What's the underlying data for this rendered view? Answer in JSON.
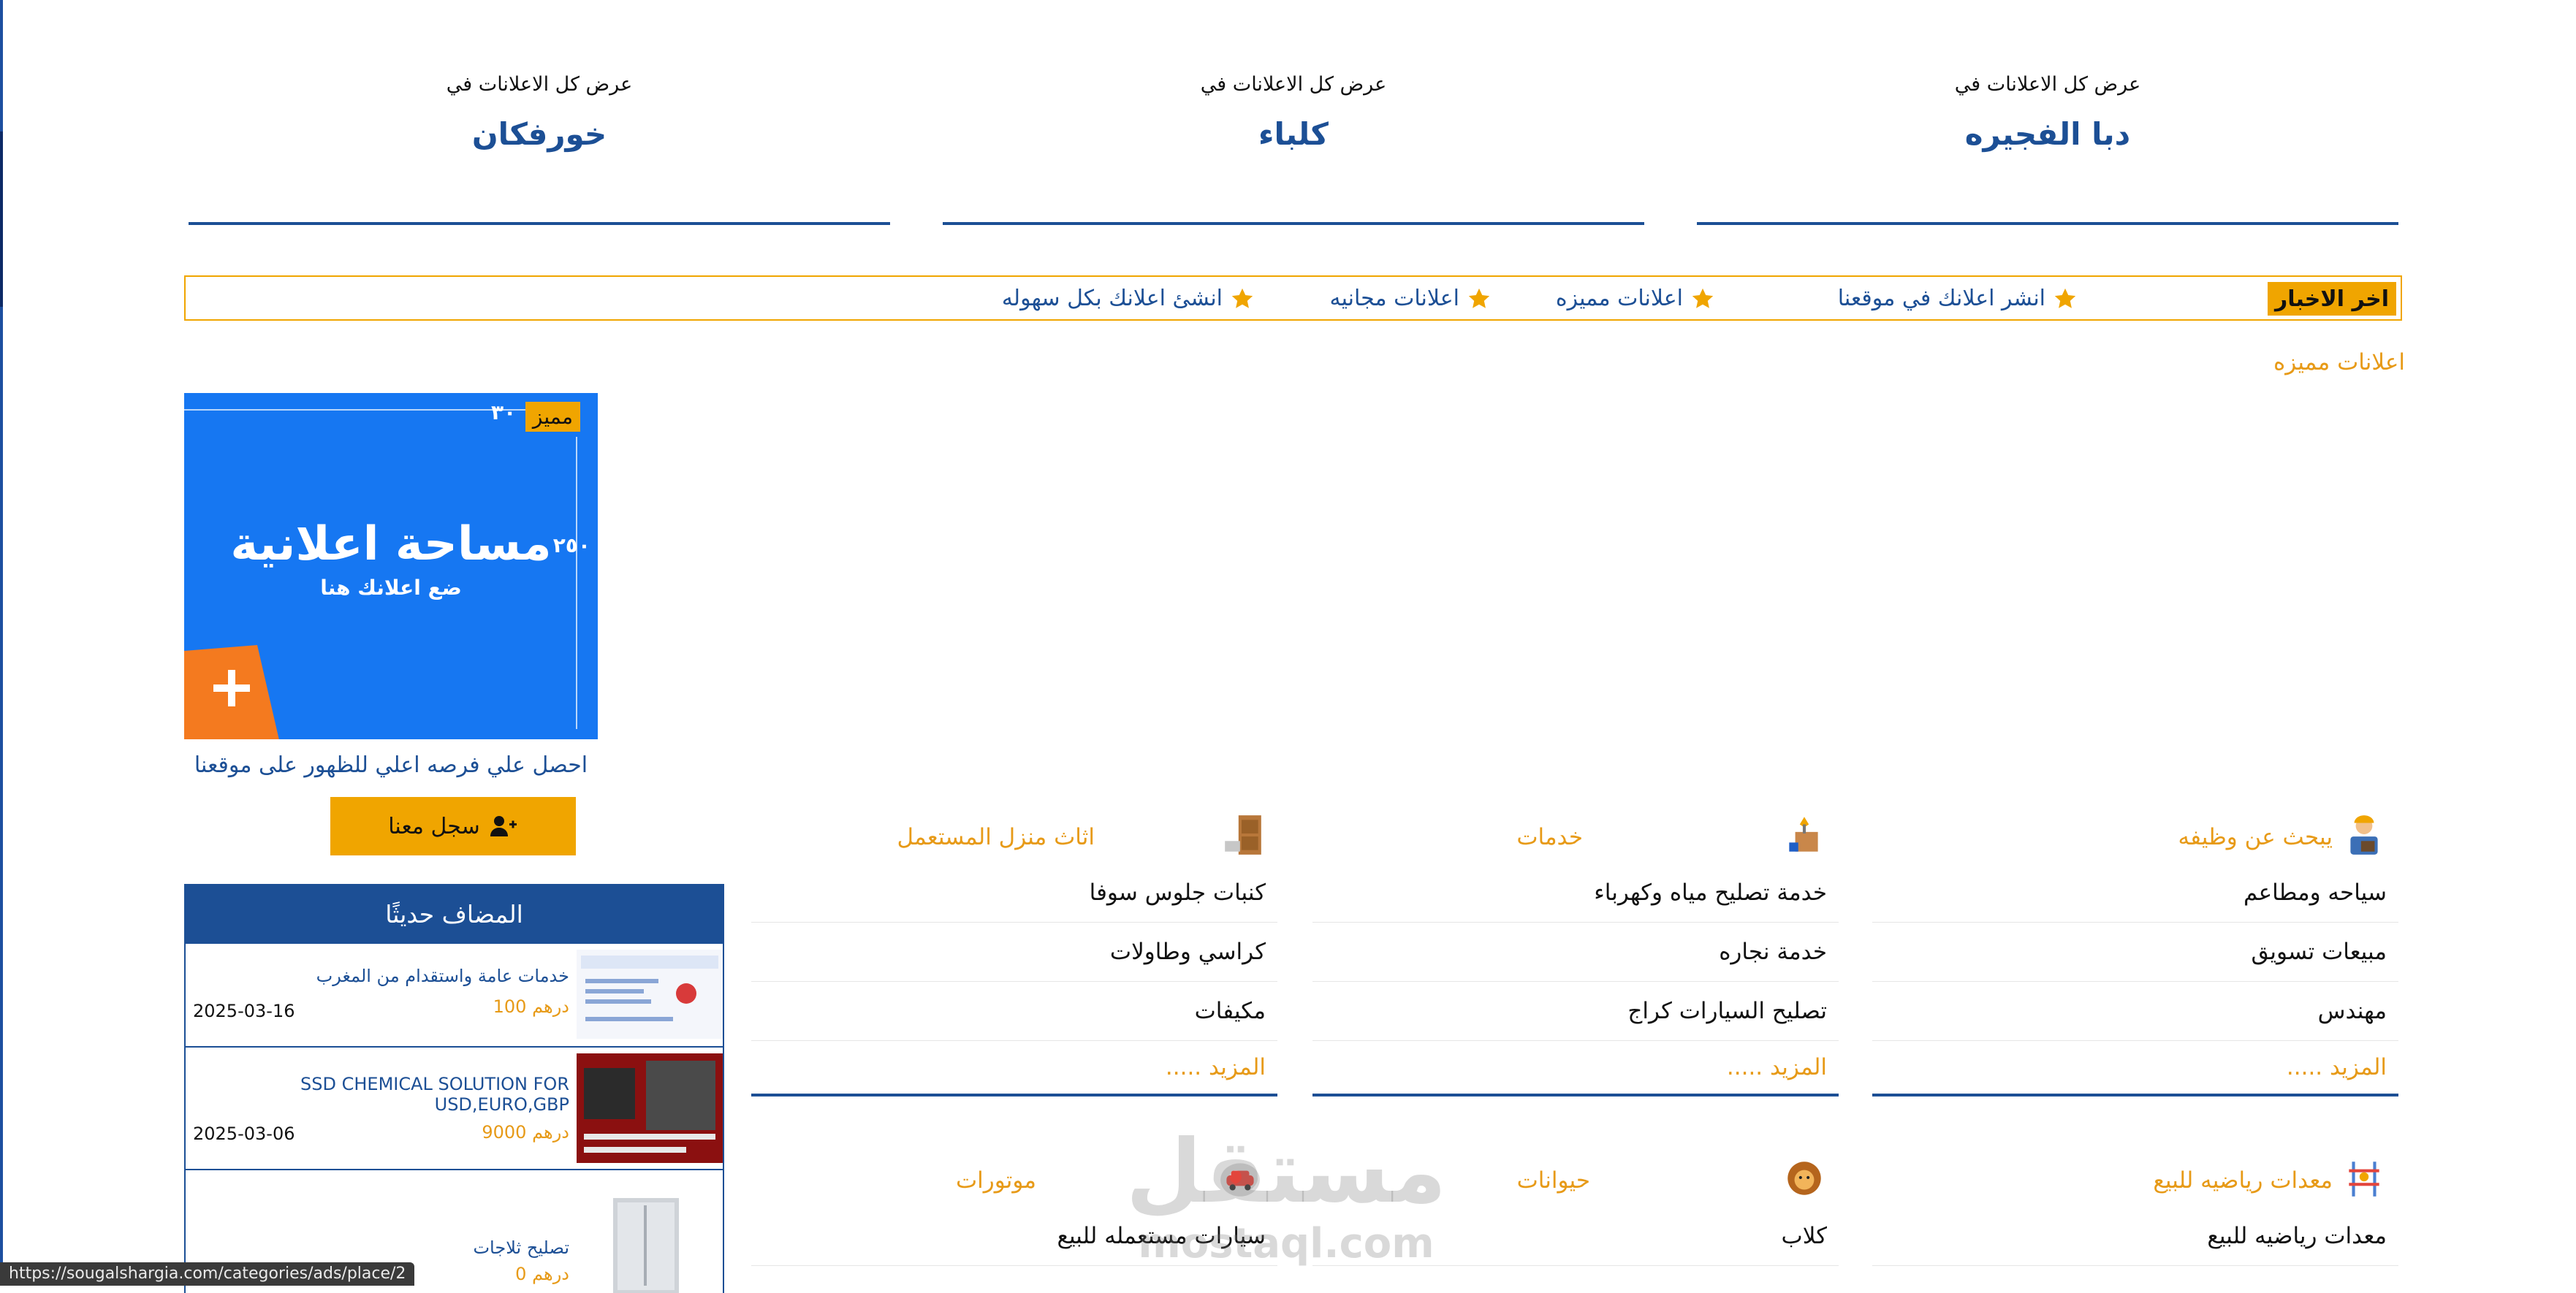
{
  "cities": [
    {
      "caption": "عرض كل الاعلانات في",
      "name": "خورفكان"
    },
    {
      "caption": "عرض كل الاعلانات في",
      "name": "كلباء"
    },
    {
      "caption": "عرض كل الاعلانات في",
      "name": "دبا الفجيره"
    }
  ],
  "ticker": {
    "label": "اخر الاخبار",
    "items": [
      "انشر اعلانك في موقعنا",
      "اعلانات مميزه",
      "اعلانات مجانيه",
      "انشئ اعلانك بكل سهوله"
    ]
  },
  "featured": {
    "title": "اعلانات مميزه",
    "ad": {
      "badge": "مميز",
      "num_top": "٣٠",
      "num_side": "٢٥٠",
      "headline": "مساحة اعلانية",
      "subline": "ضع اعلانك هنا",
      "plus": "+"
    },
    "caption": "احصل علي فرصه اعلي للظهور على موقعنا",
    "register_label": "سجل معنا"
  },
  "recent": {
    "title": "المضاف حديثًا",
    "items": [
      {
        "title": "خدمات عامة واستقدام من المغرب",
        "price": "درهم 100",
        "date": "2025-03-16"
      },
      {
        "title": "SSD CHEMICAL SOLUTION FOR USD,EURO,GBP",
        "price": "درهم 9000",
        "date": "2025-03-06"
      },
      {
        "title": "تصليح ثلاجات",
        "price": "درهم 0",
        "date": ""
      }
    ]
  },
  "categories": [
    {
      "title": "يبحث عن وظيفه",
      "icon": "worker-icon",
      "items": [
        "سياحه ومطاعم",
        "مبيعات تسويق",
        "مهندس"
      ],
      "more": "المزيد ....."
    },
    {
      "title": "خدمات",
      "icon": "services-icon",
      "items": [
        "خدمة تصليح مياه وكهرباء",
        "خدمة نجاره",
        "تصليح السيارات كراج"
      ],
      "more": "المزيد ....."
    },
    {
      "title": "اثاث منزل المستعمل",
      "icon": "furniture-icon",
      "items": [
        "كنبات جلوس سوفا",
        "كراسي وطاولات",
        "مكيفات"
      ],
      "more": "المزيد ....."
    },
    {
      "title": "معدات رياضيه للبيع",
      "icon": "gym-icon",
      "items": [
        "معدات رياضيه للبيع"
      ],
      "more": ""
    },
    {
      "title": "حيوانات",
      "icon": "lion-icon",
      "items": [
        "كلاب"
      ],
      "more": ""
    },
    {
      "title": "موتورات",
      "icon": "car-icon",
      "items": [
        "سيارات مستعمله للبيع"
      ],
      "more": ""
    }
  ],
  "watermark": {
    "line1": "مستقل",
    "line2": "mostaql.com"
  },
  "status_url": "https://sougalshargia.com/categories/ads/place/2",
  "colors": {
    "brand_blue": "#1c4f95",
    "accent_orange": "#f0a500",
    "ad_blue": "#1677f2"
  }
}
